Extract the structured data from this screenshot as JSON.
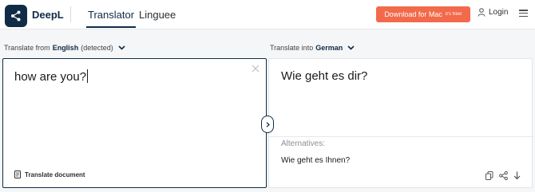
{
  "header": {
    "brand": "DeepL",
    "tabs": [
      {
        "label": "Translator",
        "active": true
      },
      {
        "label": "Linguee",
        "active": false
      }
    ],
    "download": {
      "label": "Download for Mac",
      "badge": "it's free!"
    },
    "login_label": "Login",
    "colors": {
      "brand": "#0f2b46",
      "download": "#f26a4b"
    }
  },
  "source": {
    "prefix": "Translate from",
    "language": "English",
    "suffix": "(detected)",
    "text": "how are you?",
    "translate_document_label": "Translate document"
  },
  "target": {
    "prefix": "Translate into",
    "language": "German",
    "text": "Wie geht es dir?",
    "alternatives_label": "Alternatives:",
    "alternatives": [
      "Wie geht es Ihnen?"
    ]
  },
  "icons": [
    "deepl-logo-icon",
    "user-icon",
    "menu-icon",
    "chevron-down-icon",
    "close-icon",
    "document-icon",
    "chevron-right-icon",
    "copy-icon",
    "share-icon",
    "download-icon"
  ]
}
